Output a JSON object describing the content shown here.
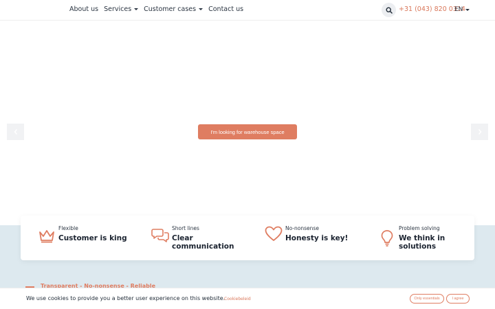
{
  "header": {
    "nav": [
      {
        "label": "About us",
        "has_caret": false
      },
      {
        "label": "Services",
        "has_caret": true
      },
      {
        "label": "Customer cases",
        "has_caret": true
      },
      {
        "label": "Contact us",
        "has_caret": false
      }
    ],
    "search_icon": "search-icon",
    "phone": "+31 (043) 820 0314",
    "language": "EN"
  },
  "hero": {
    "cta_label": "I'm looking for warehouse space",
    "prev_icon": "chevron-left-icon",
    "next_icon": "chevron-right-icon"
  },
  "features": [
    {
      "kicker": "Flexible",
      "title": "Customer is king",
      "icon": "crown-icon"
    },
    {
      "kicker": "Short lines",
      "title": "Clear communication",
      "icon": "chat-bubbles-icon"
    },
    {
      "kicker": "No-nonsense",
      "title": "Honesty is key!",
      "icon": "heart-icon"
    },
    {
      "kicker": "Problem solving",
      "title": "We think in solutions",
      "icon": "lightbulb-icon"
    }
  ],
  "tagline": "Transparent - No-nonsense - Reliable",
  "cookie": {
    "text": "We use cookies to provide you a better user experience on this website.",
    "link": "Cookiebeleid",
    "only_essentials": "Only essentials",
    "agree": "I agree"
  },
  "colors": {
    "accent": "#df7d61",
    "band": "#dde9ef",
    "text": "#1f2a36"
  }
}
